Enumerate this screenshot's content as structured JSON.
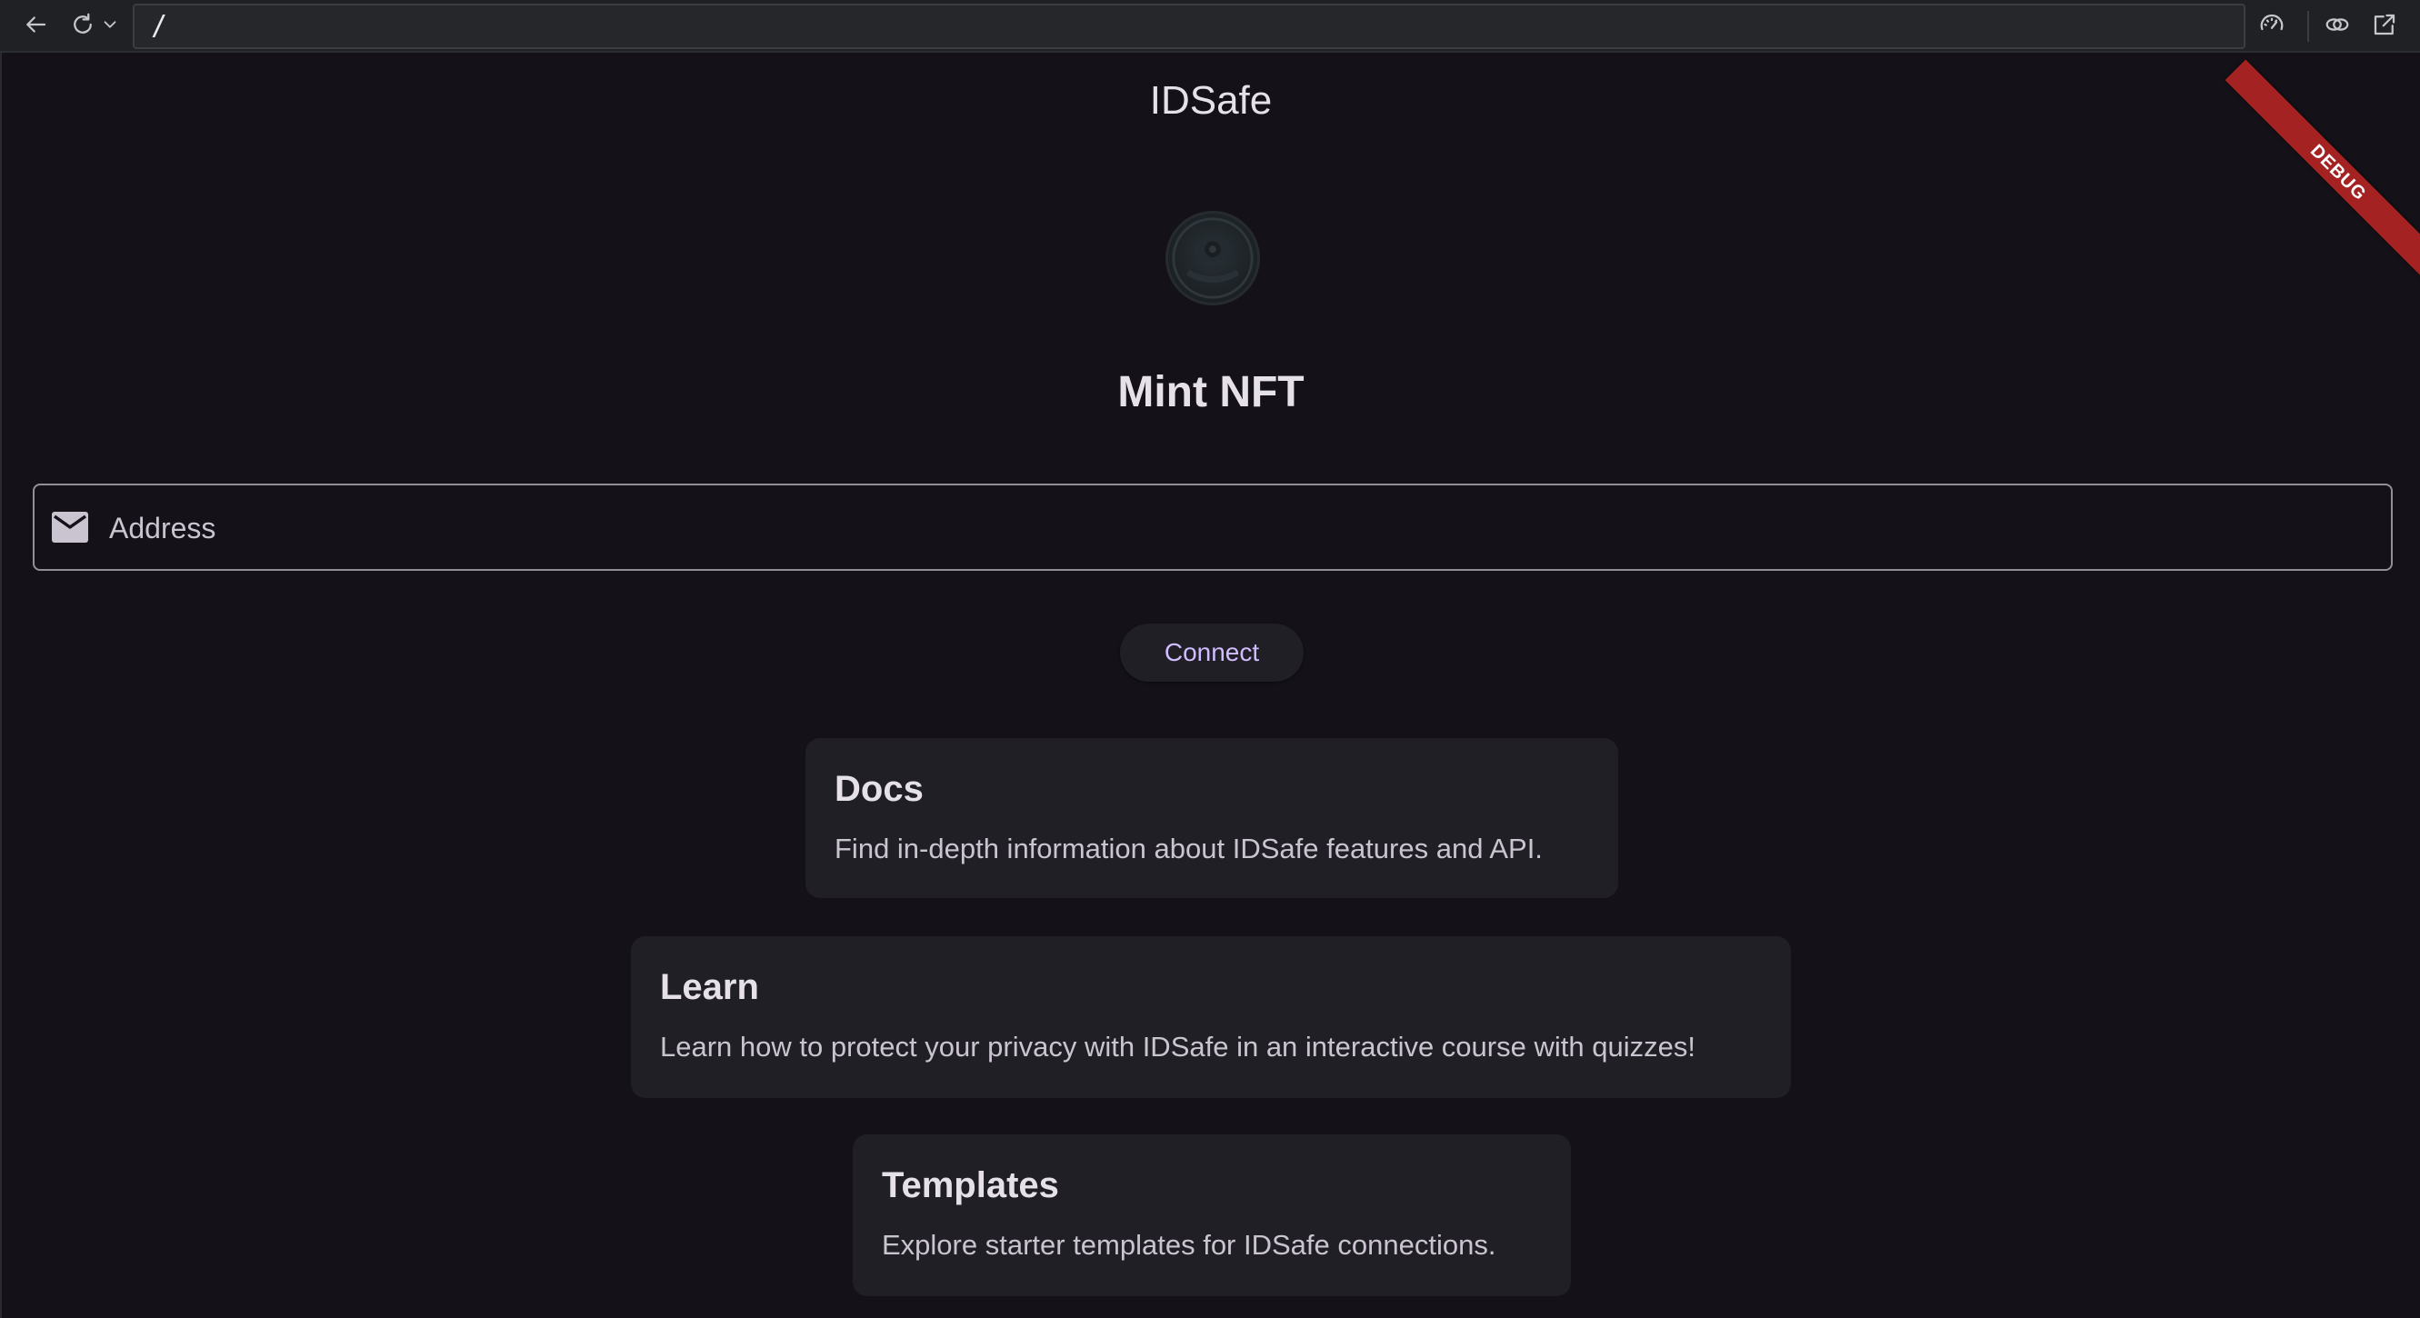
{
  "browser": {
    "url": "/",
    "icons": {
      "back": "arrow-left-icon",
      "reload": "reload-icon",
      "reload_menu": "chevron-down-icon",
      "performance": "speedometer-icon",
      "link": "link-icon",
      "open_external": "open-external-icon"
    }
  },
  "app": {
    "title": "IDSafe",
    "debug_banner": "DEBUG",
    "page_title": "Mint NFT",
    "address_field": {
      "placeholder": "Address",
      "value": "",
      "icon": "mail-icon"
    },
    "connect_label": "Connect",
    "cards": [
      {
        "title": "Docs",
        "description": "Find in-depth information about IDSafe features and API."
      },
      {
        "title": "Learn",
        "description": "Learn how to protect your privacy with IDSafe in an interactive course with quizzes!"
      },
      {
        "title": "Templates",
        "description": "Explore starter templates for IDSafe connections."
      }
    ]
  },
  "colors": {
    "background": "#141218",
    "card": "#211f26",
    "accent": "#d0bcff",
    "outline": "#938f99",
    "debug": "#a52222"
  }
}
